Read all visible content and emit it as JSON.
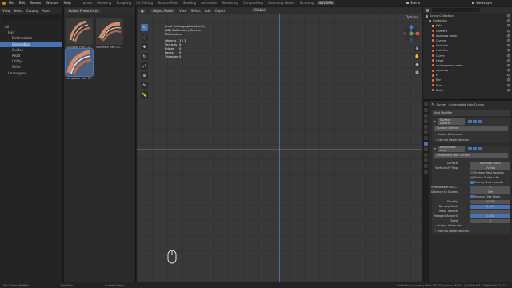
{
  "topbar": {
    "menus": [
      "File",
      "Edit",
      "Render",
      "Window",
      "Help"
    ],
    "workspaces": [
      "Layout",
      "Modeling",
      "Sculpting",
      "UV Editing",
      "Texture Paint",
      "Shading",
      "Animation",
      "Rendering",
      "Compositing",
      "Geometry Nodes",
      "Scripting",
      "ADVDAN"
    ],
    "active_workspace": "ADVDAN",
    "scene_label": "Scene",
    "viewlayer_label": "ViewLayer"
  },
  "left_panel": {
    "header": [
      "View",
      "Select",
      "Catalog",
      "Asset"
    ],
    "tree": [
      {
        "label": "All",
        "level": 0
      },
      {
        "label": "Hair",
        "level": 1
      },
      {
        "label": "Deformation",
        "level": 2
      },
      {
        "label": "Generation",
        "level": 2,
        "selected": true
      },
      {
        "label": "Guides",
        "level": 2
      },
      {
        "label": "Read",
        "level": 2
      },
      {
        "label": "Utility",
        "level": 2
      },
      {
        "label": "Write",
        "level": 2
      },
      {
        "label": "Unassigned",
        "level": 1
      }
    ]
  },
  "assets": {
    "header": "Follow Preferences",
    "items": [
      {
        "label": "Duplicate Hair Cu..."
      },
      {
        "label": "Generate Hair Cu..."
      },
      {
        "label": "Interpolate Hair C...",
        "selected": true
      }
    ]
  },
  "viewport": {
    "header_menus": [
      "View",
      "Select",
      "Add",
      "Object"
    ],
    "mode": "Object Mode",
    "orientation": "Global",
    "options_label": "Options",
    "overlay": {
      "line1": "Front Orthographic (Local)",
      "line2": "(68) Collection | Curves",
      "line3": "Millimeters",
      "stats": [
        {
          "k": "Objects",
          "v": "1 / 1"
        },
        {
          "k": "Vertices",
          "v": "0"
        },
        {
          "k": "Edges",
          "v": "0"
        },
        {
          "k": "Faces",
          "v": "0"
        },
        {
          "k": "Triangles",
          "v": "0"
        }
      ]
    },
    "tools": [
      "cursor-icon",
      "select-box-icon",
      "move-icon",
      "rotate-icon",
      "scale-icon",
      "transform-icon",
      "annotate-icon",
      "measure-icon"
    ]
  },
  "outliner": {
    "title": "Scene Collection",
    "items": [
      {
        "label": "Scene Collection",
        "color": "#9aa0a8"
      },
      {
        "label": "Collection",
        "color": "#9aa0a8"
      },
      {
        "label": "light",
        "color": "#e0b050"
      },
      {
        "label": "Camera",
        "color": "#d06060"
      },
      {
        "label": "eyebrow mesh",
        "color": "#e07040"
      },
      {
        "label": "Curves",
        "color": "#e07040"
      },
      {
        "label": "Hair line",
        "color": "#e07040"
      },
      {
        "label": "Hair line",
        "color": "#e07040"
      },
      {
        "label": "Curve",
        "color": "#e07040"
      },
      {
        "label": "Head",
        "color": "#e07040"
      },
      {
        "label": "underground mesh",
        "color": "#e07040"
      },
      {
        "label": "eyebrow",
        "color": "#e07040"
      },
      {
        "label": "H",
        "color": "#e07040"
      },
      {
        "label": "Ear",
        "color": "#e07040"
      },
      {
        "label": "Eyes",
        "color": "#e07040"
      },
      {
        "label": "Body",
        "color": "#e07040"
      }
    ]
  },
  "properties": {
    "breadcrumb_obj": "Curves",
    "breadcrumb_mod": "Interpolate Hair Curves",
    "add_modifier": "Add Modifier",
    "mod1": {
      "name": "Surface Deform",
      "field": "Surface Deform",
      "sub1": "Output Attributes",
      "sub2": "Internal Dependencies"
    },
    "mod2": {
      "name": "Interpolate Hair",
      "field": "Interpolate Hair Curves",
      "rows": [
        {
          "type": "value",
          "label": "Surface",
          "value": "eyebrow mesh"
        },
        {
          "type": "value",
          "label": "Surface UV Map",
          "value": "UVMap"
        },
        {
          "type": "check",
          "label": "",
          "text": "Surface Rest Position",
          "on": false
        },
        {
          "type": "check",
          "label": "",
          "text": "Follow Surface No...",
          "on": false
        },
        {
          "type": "check",
          "label": "",
          "text": "Part by Mesh Islands",
          "on": true
        },
        {
          "type": "value",
          "label": "Interpolation Gui...",
          "value": "4"
        },
        {
          "type": "value",
          "label": "Distance to Guides",
          "value": "0 m"
        },
        {
          "type": "check",
          "label": "",
          "text": "Poisson Disk Distri...",
          "on": true
        },
        {
          "type": "value",
          "label": "Density",
          "value": "10.000"
        },
        {
          "type": "value",
          "label": "Density Mask",
          "value": "1.000",
          "blue": true
        },
        {
          "type": "value",
          "label": "Mask Texture",
          "value": ""
        },
        {
          "type": "value",
          "label": "Viewport Amount",
          "value": "1.000",
          "blue": true
        },
        {
          "type": "value",
          "label": "Seed",
          "value": "0"
        }
      ],
      "sub1": "Output Attributes",
      "sub2": "Internal Dependencies"
    }
  },
  "statusbar": {
    "left": "Set Active Modifier",
    "middle1": "Pan View",
    "middle2": "Context Menu",
    "right": "Collection | Curves | Verts:28,578 | Faces:28,244 | Tris:56,488 | Objects:0/17 | 3.1"
  }
}
